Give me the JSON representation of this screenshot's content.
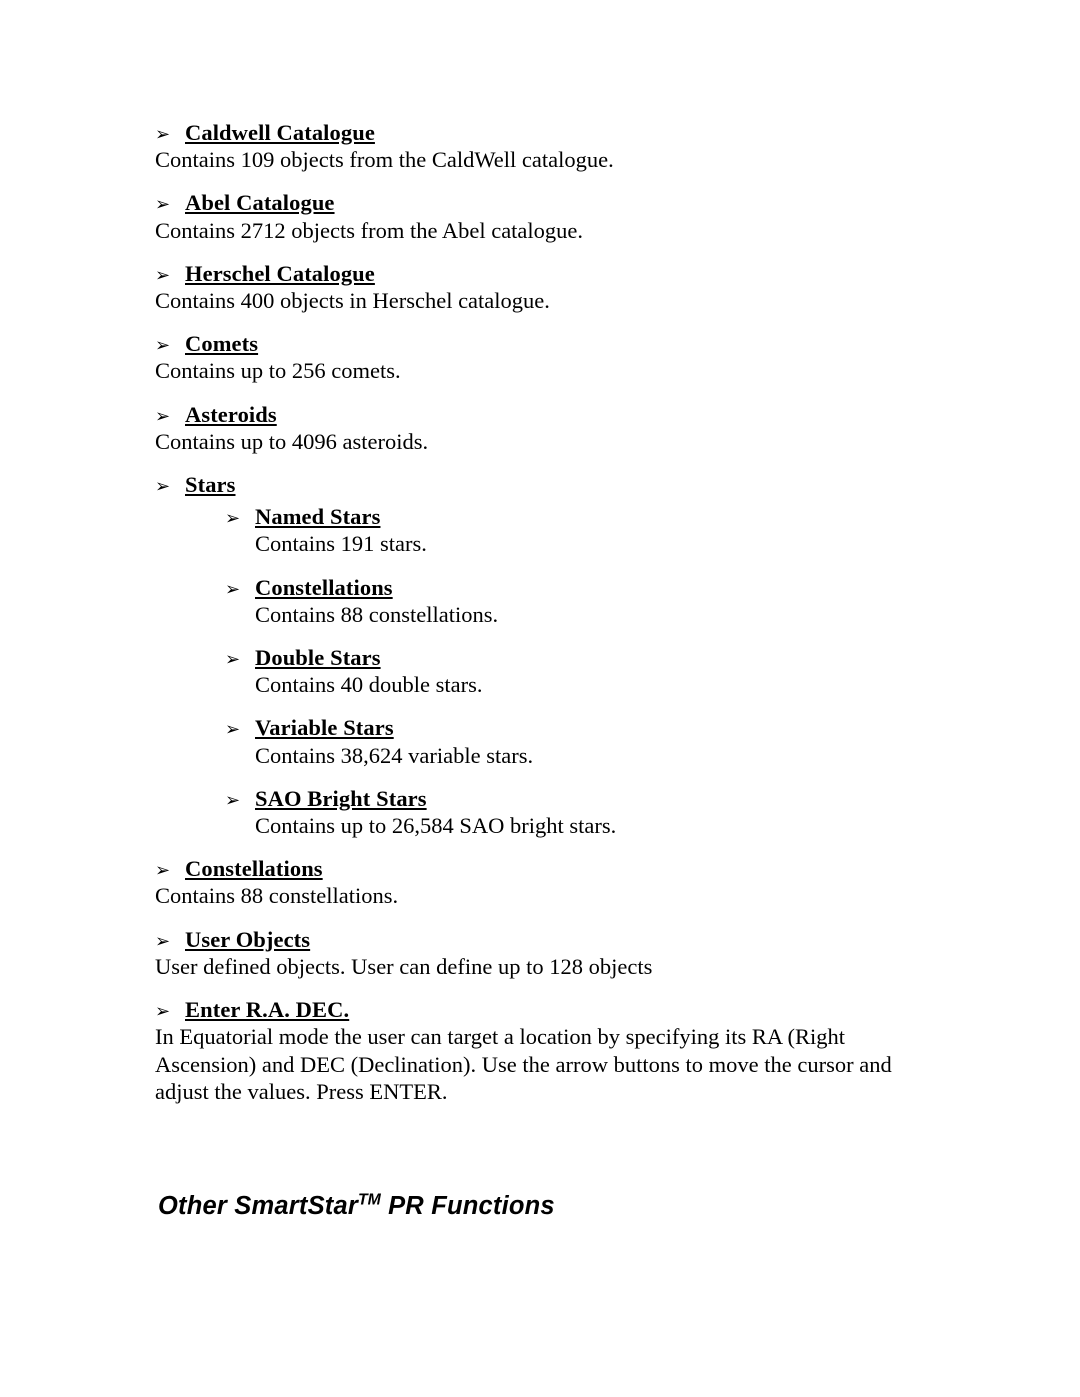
{
  "document": {
    "bullet_glyph": "➢",
    "text_color": "#000000",
    "background_color": "#ffffff"
  },
  "entries": [
    {
      "heading": "Caldwell Catalogue",
      "body": "Contains 109 objects from the CaldWell catalogue."
    },
    {
      "heading": "Abel Catalogue",
      "body": "Contains 2712 objects from the Abel catalogue."
    },
    {
      "heading": "Herschel Catalogue",
      "body": "Contains 400 objects in Herschel catalogue."
    },
    {
      "heading": "Comets",
      "body": "Contains up to 256 comets."
    },
    {
      "heading": "Asteroids",
      "body": "Contains up to 4096 asteroids."
    },
    {
      "heading": "Stars",
      "body": "",
      "children": [
        {
          "heading": "Named Stars",
          "body": "Contains 191 stars."
        },
        {
          "heading": "Constellations",
          "body": "Contains 88 constellations."
        },
        {
          "heading": "Double Stars",
          "body": "Contains 40 double stars."
        },
        {
          "heading": "Variable Stars",
          "body": "Contains 38,624 variable stars."
        },
        {
          "heading": "SAO Bright Stars",
          "body": "Contains up to 26,584 SAO bright stars."
        }
      ]
    },
    {
      "heading": "Constellations",
      "body": "Contains 88 constellations."
    },
    {
      "heading": "User Objects",
      "body": "User defined objects. User can define up to 128 objects"
    },
    {
      "heading": "Enter R.A. DEC.",
      "body": "In Equatorial mode the user can target a location by specifying its RA (Right Ascension) and DEC (Declination). Use the arrow buttons to move the cursor and adjust the values. Press ENTER."
    }
  ],
  "section_heading": {
    "before": "Other SmartStar",
    "superscript": "TM",
    "after": " PR Functions"
  }
}
